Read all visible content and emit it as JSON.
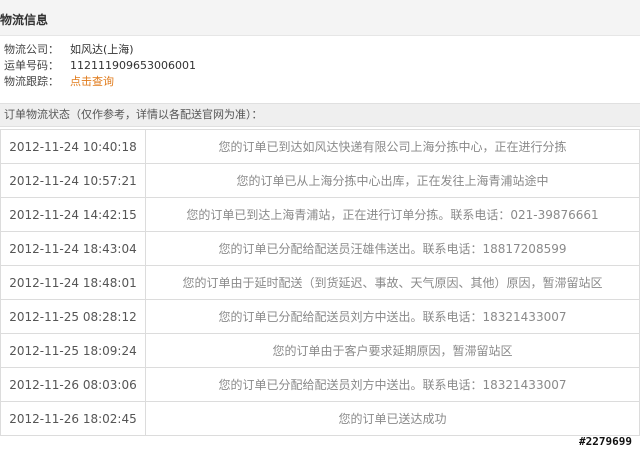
{
  "header": {
    "title": "物流信息"
  },
  "info": {
    "company_label": "物流公司：",
    "company_value": "如风达(上海)",
    "waybill_label": "运单号码：",
    "waybill_value": "112111909653006001",
    "tracking_label": "物流跟踪：",
    "tracking_link": "点击查询"
  },
  "status": {
    "heading": "订单物流状态（仅作参考，详情以各配送官网为准）："
  },
  "log": [
    {
      "time": "2012-11-24 10:40:18",
      "desc": "您的订单已到达如风达快递有限公司上海分拣中心，正在进行分拣"
    },
    {
      "time": "2012-11-24 10:57:21",
      "desc": "您的订单已从上海分拣中心出库，正在发往上海青浦站途中"
    },
    {
      "time": "2012-11-24 14:42:15",
      "desc": "您的订单已到达上海青浦站，正在进行订单分拣。联系电话：021-39876661"
    },
    {
      "time": "2012-11-24 18:43:04",
      "desc": "您的订单已分配给配送员汪雄伟送出。联系电话：18817208599"
    },
    {
      "time": "2012-11-24 18:48:01",
      "desc": "您的订单由于延时配送（到货延迟、事故、天气原因、其他）原因，暂滞留站区"
    },
    {
      "time": "2012-11-25 08:28:12",
      "desc": "您的订单已分配给配送员刘方中送出。联系电话：18321433007"
    },
    {
      "time": "2012-11-25 18:09:24",
      "desc": "您的订单由于客户要求延期原因，暂滞留站区"
    },
    {
      "time": "2012-11-26 08:03:06",
      "desc": "您的订单已分配给配送员刘方中送出。联系电话：18321433007"
    },
    {
      "time": "2012-11-26 18:02:45",
      "desc": "您的订单已送达成功"
    }
  ],
  "watermark": "#2279699"
}
